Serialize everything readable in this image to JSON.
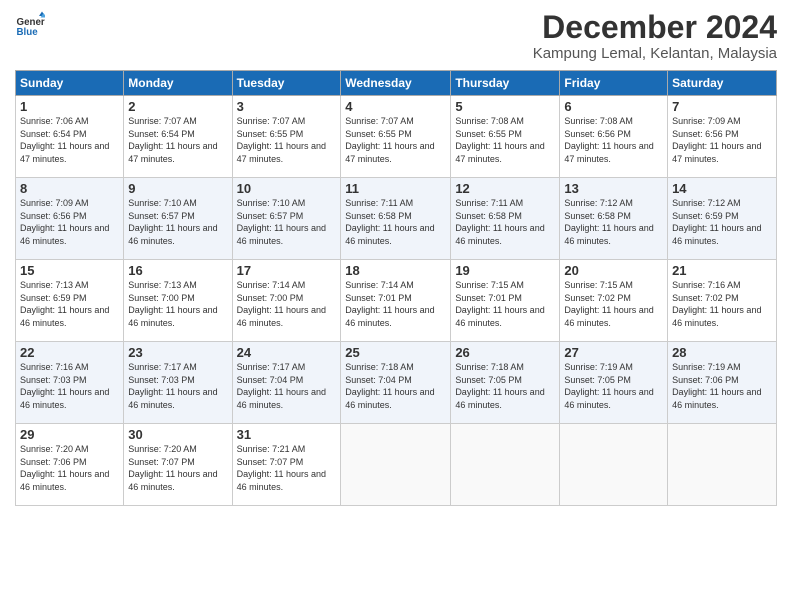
{
  "header": {
    "logo_line1": "General",
    "logo_line2": "Blue",
    "month_title": "December 2024",
    "location": "Kampung Lemal, Kelantan, Malaysia"
  },
  "days_of_week": [
    "Sunday",
    "Monday",
    "Tuesday",
    "Wednesday",
    "Thursday",
    "Friday",
    "Saturday"
  ],
  "weeks": [
    [
      {
        "day": "1",
        "sunrise": "7:06 AM",
        "sunset": "6:54 PM",
        "daylight": "11 hours and 47 minutes."
      },
      {
        "day": "2",
        "sunrise": "7:07 AM",
        "sunset": "6:54 PM",
        "daylight": "11 hours and 47 minutes."
      },
      {
        "day": "3",
        "sunrise": "7:07 AM",
        "sunset": "6:55 PM",
        "daylight": "11 hours and 47 minutes."
      },
      {
        "day": "4",
        "sunrise": "7:07 AM",
        "sunset": "6:55 PM",
        "daylight": "11 hours and 47 minutes."
      },
      {
        "day": "5",
        "sunrise": "7:08 AM",
        "sunset": "6:55 PM",
        "daylight": "11 hours and 47 minutes."
      },
      {
        "day": "6",
        "sunrise": "7:08 AM",
        "sunset": "6:56 PM",
        "daylight": "11 hours and 47 minutes."
      },
      {
        "day": "7",
        "sunrise": "7:09 AM",
        "sunset": "6:56 PM",
        "daylight": "11 hours and 47 minutes."
      }
    ],
    [
      {
        "day": "8",
        "sunrise": "7:09 AM",
        "sunset": "6:56 PM",
        "daylight": "11 hours and 46 minutes."
      },
      {
        "day": "9",
        "sunrise": "7:10 AM",
        "sunset": "6:57 PM",
        "daylight": "11 hours and 46 minutes."
      },
      {
        "day": "10",
        "sunrise": "7:10 AM",
        "sunset": "6:57 PM",
        "daylight": "11 hours and 46 minutes."
      },
      {
        "day": "11",
        "sunrise": "7:11 AM",
        "sunset": "6:58 PM",
        "daylight": "11 hours and 46 minutes."
      },
      {
        "day": "12",
        "sunrise": "7:11 AM",
        "sunset": "6:58 PM",
        "daylight": "11 hours and 46 minutes."
      },
      {
        "day": "13",
        "sunrise": "7:12 AM",
        "sunset": "6:58 PM",
        "daylight": "11 hours and 46 minutes."
      },
      {
        "day": "14",
        "sunrise": "7:12 AM",
        "sunset": "6:59 PM",
        "daylight": "11 hours and 46 minutes."
      }
    ],
    [
      {
        "day": "15",
        "sunrise": "7:13 AM",
        "sunset": "6:59 PM",
        "daylight": "11 hours and 46 minutes."
      },
      {
        "day": "16",
        "sunrise": "7:13 AM",
        "sunset": "7:00 PM",
        "daylight": "11 hours and 46 minutes."
      },
      {
        "day": "17",
        "sunrise": "7:14 AM",
        "sunset": "7:00 PM",
        "daylight": "11 hours and 46 minutes."
      },
      {
        "day": "18",
        "sunrise": "7:14 AM",
        "sunset": "7:01 PM",
        "daylight": "11 hours and 46 minutes."
      },
      {
        "day": "19",
        "sunrise": "7:15 AM",
        "sunset": "7:01 PM",
        "daylight": "11 hours and 46 minutes."
      },
      {
        "day": "20",
        "sunrise": "7:15 AM",
        "sunset": "7:02 PM",
        "daylight": "11 hours and 46 minutes."
      },
      {
        "day": "21",
        "sunrise": "7:16 AM",
        "sunset": "7:02 PM",
        "daylight": "11 hours and 46 minutes."
      }
    ],
    [
      {
        "day": "22",
        "sunrise": "7:16 AM",
        "sunset": "7:03 PM",
        "daylight": "11 hours and 46 minutes."
      },
      {
        "day": "23",
        "sunrise": "7:17 AM",
        "sunset": "7:03 PM",
        "daylight": "11 hours and 46 minutes."
      },
      {
        "day": "24",
        "sunrise": "7:17 AM",
        "sunset": "7:04 PM",
        "daylight": "11 hours and 46 minutes."
      },
      {
        "day": "25",
        "sunrise": "7:18 AM",
        "sunset": "7:04 PM",
        "daylight": "11 hours and 46 minutes."
      },
      {
        "day": "26",
        "sunrise": "7:18 AM",
        "sunset": "7:05 PM",
        "daylight": "11 hours and 46 minutes."
      },
      {
        "day": "27",
        "sunrise": "7:19 AM",
        "sunset": "7:05 PM",
        "daylight": "11 hours and 46 minutes."
      },
      {
        "day": "28",
        "sunrise": "7:19 AM",
        "sunset": "7:06 PM",
        "daylight": "11 hours and 46 minutes."
      }
    ],
    [
      {
        "day": "29",
        "sunrise": "7:20 AM",
        "sunset": "7:06 PM",
        "daylight": "11 hours and 46 minutes."
      },
      {
        "day": "30",
        "sunrise": "7:20 AM",
        "sunset": "7:07 PM",
        "daylight": "11 hours and 46 minutes."
      },
      {
        "day": "31",
        "sunrise": "7:21 AM",
        "sunset": "7:07 PM",
        "daylight": "11 hours and 46 minutes."
      },
      null,
      null,
      null,
      null
    ]
  ]
}
